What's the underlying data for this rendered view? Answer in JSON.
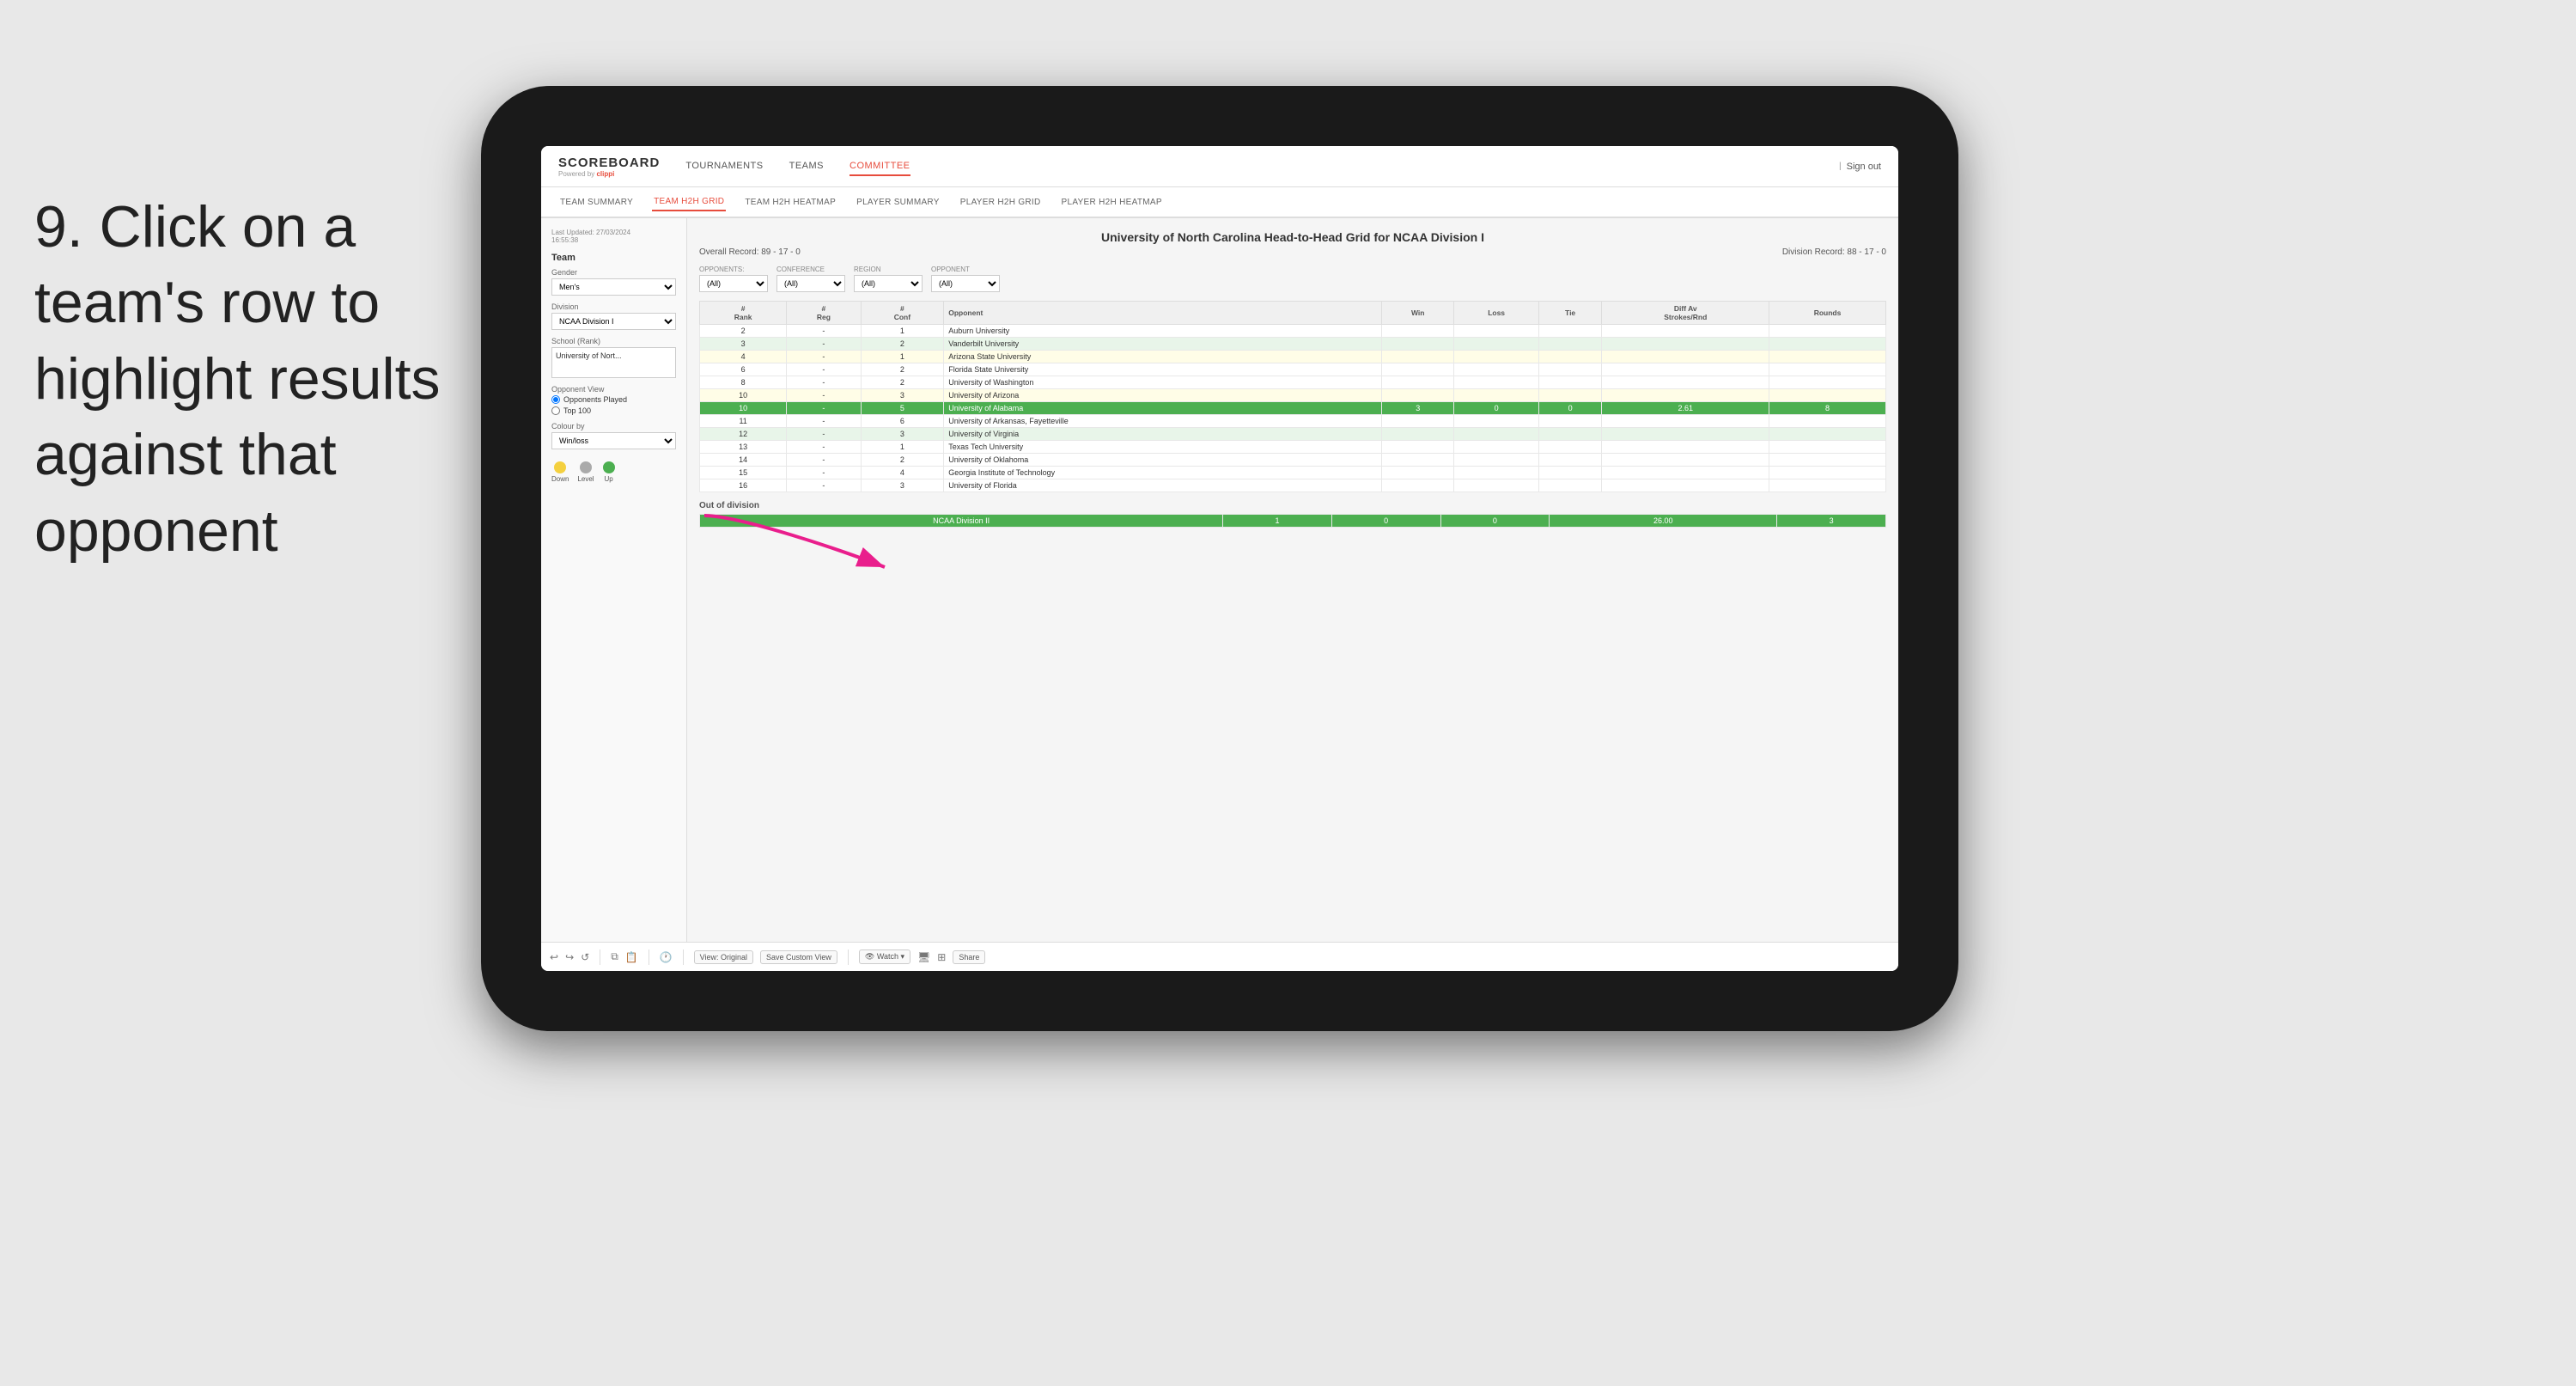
{
  "instruction": {
    "step": "9.",
    "text": "Click on a team's row to highlight results against that opponent"
  },
  "nav": {
    "logo": "SCOREBOARD",
    "logo_sub": "Powered by",
    "logo_brand": "clippi",
    "links": [
      "TOURNAMENTS",
      "TEAMS",
      "COMMITTEE"
    ],
    "sign_out": "Sign out",
    "active_link": "COMMITTEE"
  },
  "sub_nav": {
    "links": [
      "TEAM SUMMARY",
      "TEAM H2H GRID",
      "TEAM H2H HEATMAP",
      "PLAYER SUMMARY",
      "PLAYER H2H GRID",
      "PLAYER H2H HEATMAP"
    ],
    "active": "TEAM H2H GRID"
  },
  "sidebar": {
    "timestamp_label": "Last Updated: 27/03/2024",
    "timestamp_time": "16:55:38",
    "team_section": "Team",
    "gender_label": "Gender",
    "gender_value": "Men's",
    "division_label": "Division",
    "division_value": "NCAA Division I",
    "school_label": "School (Rank)",
    "school_value": "University of Nort...",
    "opponent_view_label": "Opponent View",
    "opponents_played": "Opponents Played",
    "top_100": "Top 100",
    "colour_by_label": "Colour by",
    "colour_by_value": "Win/loss",
    "legend": [
      {
        "label": "Down",
        "color": "#f4d03f"
      },
      {
        "label": "Level",
        "color": "#aaaaaa"
      },
      {
        "label": "Up",
        "color": "#4caf50"
      }
    ]
  },
  "grid": {
    "title": "University of North Carolina Head-to-Head Grid for NCAA Division I",
    "overall_record_label": "Overall Record:",
    "overall_record": "89 - 17 - 0",
    "division_record_label": "Division Record:",
    "division_record": "88 - 17 - 0",
    "filters": {
      "opponents_label": "Opponents:",
      "opponents_value": "(All)",
      "conference_label": "Conference",
      "conference_value": "(All)",
      "region_label": "Region",
      "region_value": "(All)",
      "opponent_label": "Opponent",
      "opponent_value": "(All)"
    },
    "table_headers": [
      "#\nRank",
      "#\nReg",
      "#\nConf",
      "Opponent",
      "Win",
      "Loss",
      "Tie",
      "Diff Av\nStrokes/Rnd",
      "Rounds"
    ],
    "rows": [
      {
        "rank": "2",
        "reg": "-",
        "conf": "1",
        "opponent": "Auburn University",
        "win": "",
        "loss": "",
        "tie": "",
        "diff": "",
        "rounds": "",
        "style": "light"
      },
      {
        "rank": "3",
        "reg": "-",
        "conf": "2",
        "opponent": "Vanderbilt University",
        "win": "",
        "loss": "",
        "tie": "",
        "diff": "",
        "rounds": "",
        "style": "light-green"
      },
      {
        "rank": "4",
        "reg": "-",
        "conf": "1",
        "opponent": "Arizona State University",
        "win": "",
        "loss": "",
        "tie": "",
        "diff": "",
        "rounds": "",
        "style": "light-yellow"
      },
      {
        "rank": "6",
        "reg": "-",
        "conf": "2",
        "opponent": "Florida State University",
        "win": "",
        "loss": "",
        "tie": "",
        "diff": "",
        "rounds": "",
        "style": "light"
      },
      {
        "rank": "8",
        "reg": "-",
        "conf": "2",
        "opponent": "University of Washington",
        "win": "",
        "loss": "",
        "tie": "",
        "diff": "",
        "rounds": "",
        "style": "light"
      },
      {
        "rank": "10",
        "reg": "-",
        "conf": "3",
        "opponent": "University of Arizona",
        "win": "",
        "loss": "",
        "tie": "",
        "diff": "",
        "rounds": "",
        "style": "light-yellow"
      },
      {
        "rank": "10",
        "reg": "-",
        "conf": "5",
        "opponent": "University of Alabama",
        "win": "3",
        "loss": "0",
        "tie": "0",
        "diff": "2.61",
        "rounds": "8",
        "style": "highlight"
      },
      {
        "rank": "11",
        "reg": "-",
        "conf": "6",
        "opponent": "University of Arkansas, Fayetteville",
        "win": "",
        "loss": "",
        "tie": "",
        "diff": "",
        "rounds": "",
        "style": "light"
      },
      {
        "rank": "12",
        "reg": "-",
        "conf": "3",
        "opponent": "University of Virginia",
        "win": "",
        "loss": "",
        "tie": "",
        "diff": "",
        "rounds": "",
        "style": "light-green"
      },
      {
        "rank": "13",
        "reg": "-",
        "conf": "1",
        "opponent": "Texas Tech University",
        "win": "",
        "loss": "",
        "tie": "",
        "diff": "",
        "rounds": "",
        "style": "light"
      },
      {
        "rank": "14",
        "reg": "-",
        "conf": "2",
        "opponent": "University of Oklahoma",
        "win": "",
        "loss": "",
        "tie": "",
        "diff": "",
        "rounds": "",
        "style": "light"
      },
      {
        "rank": "15",
        "reg": "-",
        "conf": "4",
        "opponent": "Georgia Institute of Technology",
        "win": "",
        "loss": "",
        "tie": "",
        "diff": "",
        "rounds": "",
        "style": "light"
      },
      {
        "rank": "16",
        "reg": "-",
        "conf": "3",
        "opponent": "University of Florida",
        "win": "",
        "loss": "",
        "tie": "",
        "diff": "",
        "rounds": "",
        "style": "light"
      }
    ],
    "out_of_division_label": "Out of division",
    "out_of_division_row": {
      "name": "NCAA Division II",
      "win": "1",
      "loss": "0",
      "tie": "0",
      "diff": "26.00",
      "rounds": "3"
    }
  },
  "toolbar": {
    "view_label": "View: Original",
    "save_label": "Save Custom View",
    "watch_label": "Watch",
    "share_label": "Share"
  }
}
